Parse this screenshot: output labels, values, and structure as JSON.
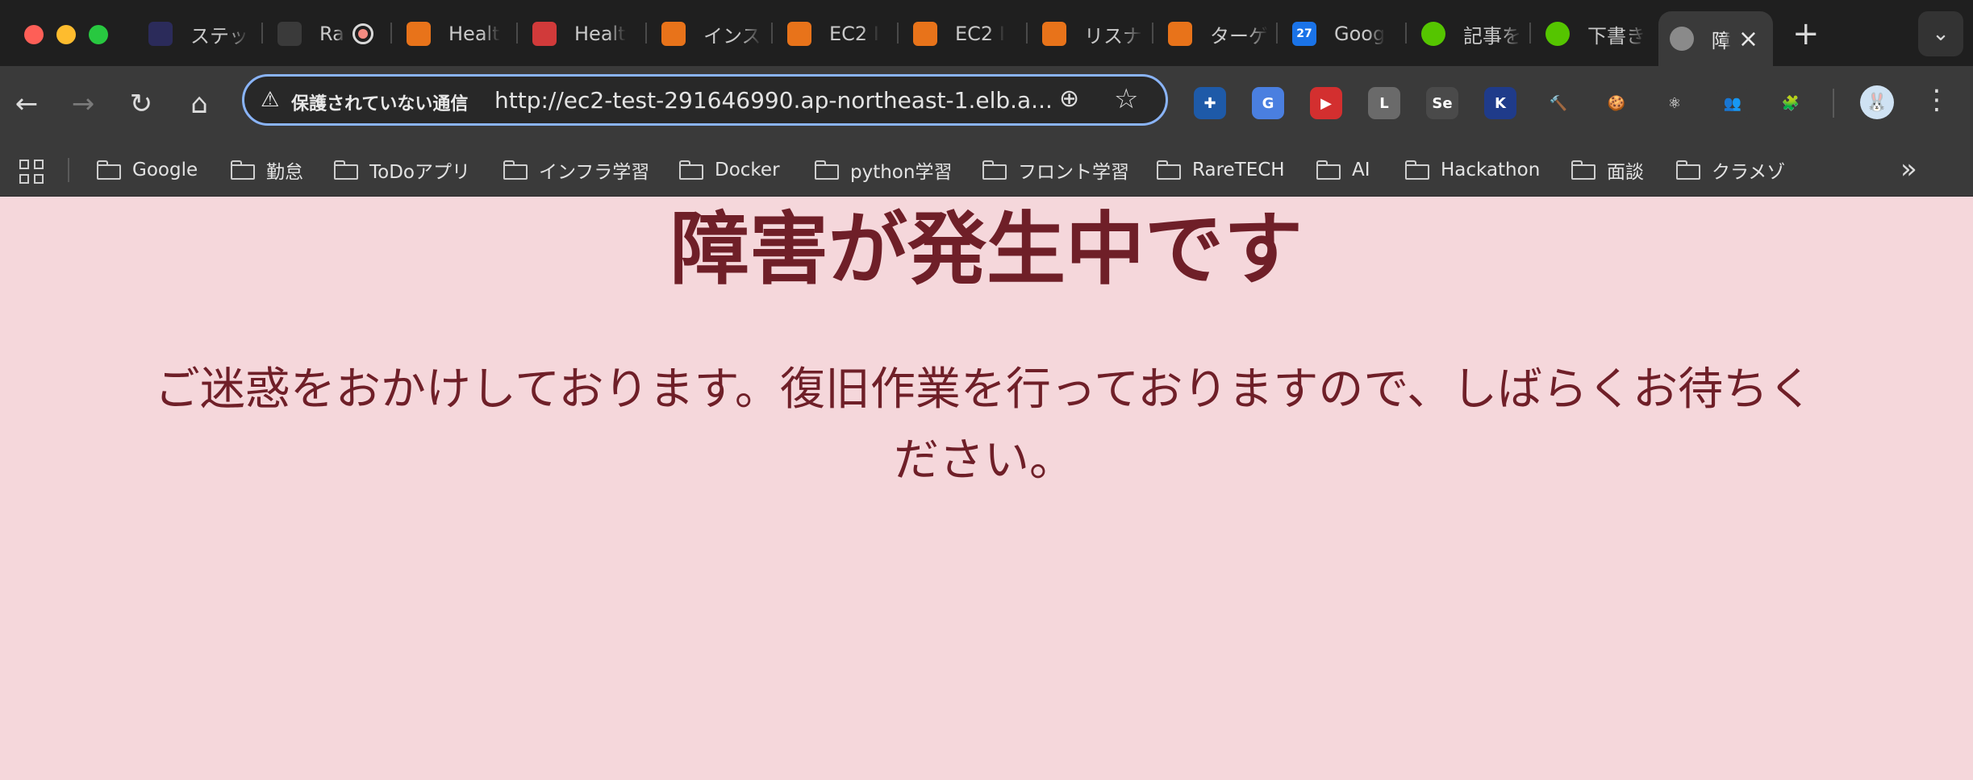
{
  "tabs": [
    {
      "label": "ステッ",
      "icon": "dark-logo-icon",
      "color": "#2b2b5a"
    },
    {
      "label": "Ra",
      "icon": "screen-record-icon",
      "color": "#3a3a3a",
      "recording": true
    },
    {
      "label": "Healt",
      "icon": "aws-lambda-icon",
      "color": "#e8731a"
    },
    {
      "label": "Healt",
      "icon": "aws-cloudwatch-icon",
      "color": "#d13a3a"
    },
    {
      "label": "インス",
      "icon": "aws-elb-icon",
      "color": "#e8731a"
    },
    {
      "label": "EC2 I",
      "icon": "aws-ec2-cube-icon",
      "color": "#e8731a"
    },
    {
      "label": "EC2 I",
      "icon": "aws-ec2-cube-icon",
      "color": "#e8731a"
    },
    {
      "label": "リスナ",
      "icon": "aws-elb-icon",
      "color": "#e8731a"
    },
    {
      "label": "ターゲ",
      "icon": "aws-elb-icon",
      "color": "#e8731a"
    },
    {
      "label": "Goog",
      "icon": "google-calendar-icon",
      "color": "#1a73e8",
      "badge": "27"
    },
    {
      "label": "記事を",
      "icon": "qiita-icon",
      "color": "#55c500"
    },
    {
      "label": "下書き",
      "icon": "qiita-icon",
      "color": "#55c500"
    },
    {
      "label": "障",
      "icon": "globe-icon",
      "color": "#8a8a8a",
      "active": true
    }
  ],
  "toolbar": {
    "security_label": "保護されていない通信",
    "url": "http://ec2-test-291646990.ap-northeast-1.elb.a..."
  },
  "extensions": [
    {
      "name": "ext-blue-cross-icon",
      "color": "#1e5aa8",
      "glyph": "✚"
    },
    {
      "name": "ext-google-translate-icon",
      "color": "#4a7fe0",
      "glyph": "G"
    },
    {
      "name": "ext-youtube-icon",
      "color": "#d32f2f",
      "glyph": "▶"
    },
    {
      "name": "ext-line-icon",
      "color": "#6a6a6a",
      "glyph": "L"
    },
    {
      "name": "ext-selenium-icon",
      "color": "#4a4a4a",
      "glyph": "Se"
    },
    {
      "name": "ext-k-icon",
      "color": "#1f3b8a",
      "glyph": "K"
    },
    {
      "name": "ext-hammer-icon",
      "color": "#3a3a3a",
      "glyph": "🔨"
    },
    {
      "name": "ext-cookie-icon",
      "color": "#3a3a3a",
      "glyph": "🍪"
    },
    {
      "name": "ext-react-icon",
      "color": "#3a3a3a",
      "glyph": "⚛"
    },
    {
      "name": "ext-people-icon",
      "color": "#3a3a3a",
      "glyph": "👥"
    },
    {
      "name": "ext-puzzle-icon",
      "color": "#3a3a3a",
      "glyph": "🧩"
    }
  ],
  "bookmarks": [
    "Google",
    "勤怠",
    "ToDoアプリ",
    "インフラ学習",
    "Docker",
    "python学習",
    "フロント学習",
    "RareTECH",
    "AI",
    "Hackathon",
    "面談",
    "クラメゾ"
  ],
  "page": {
    "title": "障害が発生中です",
    "message": "ご迷惑をおかけしております。復旧作業を行っておりますので、しばらくお待ちください。"
  },
  "colors": {
    "page_bg": "#f5d7db",
    "text": "#6f1f28",
    "omnibox_border": "#8ab4f8"
  }
}
